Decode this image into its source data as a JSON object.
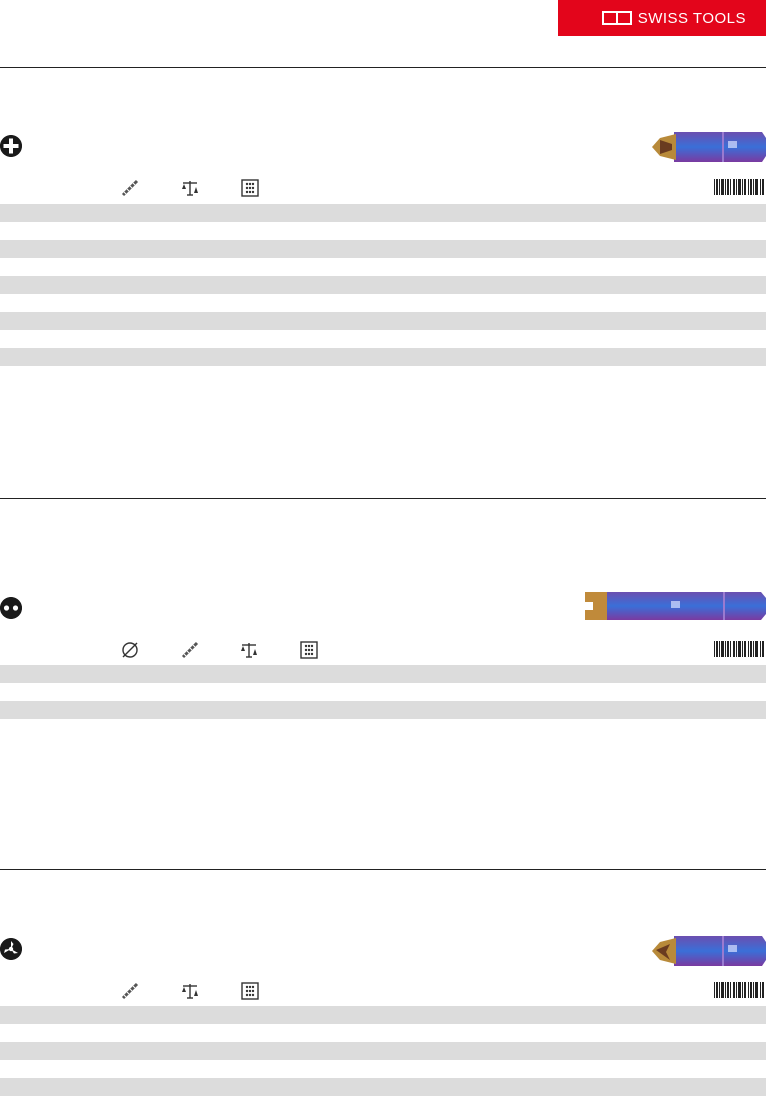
{
  "brand": {
    "name": "SWISS TOOLS",
    "logo_mark": "PB",
    "color": "#e3051b"
  },
  "sections": [
    {
      "type_icon": "phillips-cross-icon",
      "columns": [
        "length-icon",
        "weight-icon",
        "packaging-icon"
      ],
      "stripe_rows": 5
    },
    {
      "type_icon": "spanner-two-hole-icon",
      "columns": [
        "diameter-icon",
        "length-icon",
        "weight-icon",
        "packaging-icon"
      ],
      "stripe_rows": 2
    },
    {
      "type_icon": "tri-wing-icon",
      "columns": [
        "length-icon",
        "weight-icon",
        "packaging-icon"
      ],
      "stripe_rows": 3
    }
  ],
  "colors": {
    "stripe": "#dcdcdc",
    "rule": "#222222"
  }
}
